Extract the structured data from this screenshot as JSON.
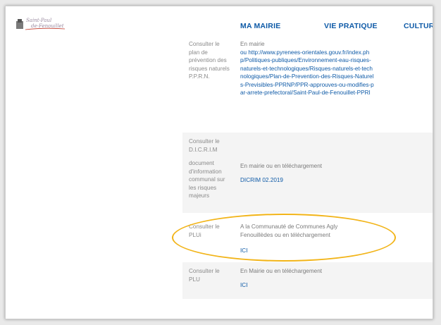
{
  "header": {
    "logo_text": "Saint-Paul de-Fenouillet",
    "nav": [
      "MA MAIRIE",
      "VIE PRATIQUE",
      "CULTURE"
    ]
  },
  "rows": [
    {
      "label": "Consulter le plan de prévention des risques naturels P.P.R.N.",
      "value_prefix": "En mairie",
      "value_link": "ou http://www.pyrenees-orientales.gouv.fr/index.php/Politiques-publiques/Environnement-eau-risques-naturels-et-technologiques/Risques-naturels-et-technologiques/Plan-de-Prevention-des-Risques-Naturels-Previsibles-PPRNP/PPR-approuves-ou-modifies-par-arrete-prefectoral/Saint-Paul-de-Fenouillet-PPRI"
    },
    {
      "label": "Consulter le D.I.C.R.I.M",
      "label2": "document d'information communal sur les risques majeurs",
      "value": "En mairie ou en téléchargement",
      "link": "DICRIM 02.2019"
    },
    {
      "label": "Consulter le PLUi",
      "value": "A la Communauté de Communes Agly Fenouillèdes ou en téléchargement",
      "link": "ICI"
    },
    {
      "label": "Consulter le PLU",
      "value": "En Mairie ou en téléchargement",
      "link": "ICI"
    }
  ],
  "colors": {
    "link": "#0e5aa7",
    "highlight": "#f2b418"
  }
}
